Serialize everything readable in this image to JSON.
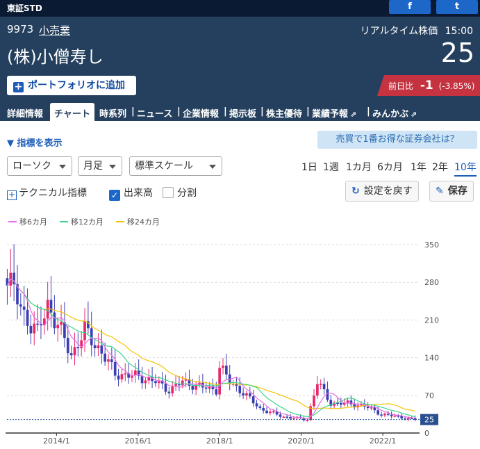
{
  "topbar": {
    "market": "東証STD",
    "facebook": "f",
    "twitter": "t"
  },
  "stock": {
    "code": "9973",
    "sector": "小売業",
    "realtime_label": "リアルタイム株価",
    "time": "15:00",
    "name": "(株)小僧寿し",
    "price": "25"
  },
  "portfolio_button": {
    "label": "ポートフォリオに追加",
    "icon": "+"
  },
  "change": {
    "label": "前日比",
    "value": "-1",
    "percent": "(-3.85%)"
  },
  "tabs": [
    {
      "label": "詳細情報"
    },
    {
      "label": "チャート"
    },
    {
      "label": "時系列"
    },
    {
      "label": "ニュース"
    },
    {
      "label": "企業情報"
    },
    {
      "label": "掲示板"
    },
    {
      "label": "株主優待"
    },
    {
      "label": "業績予報"
    },
    {
      "label": "みんかぶ"
    }
  ],
  "tab_separator": "|",
  "ext_icon": "⇗",
  "controls": {
    "indicator_toggle": "▼ 指標を表示",
    "promo": "売買で1番お得な証券会社は？",
    "chart_type": "ローソク",
    "interval": "月足",
    "scale": "標準スケール",
    "periods": [
      "1日",
      "1週",
      "1カ月",
      "6カ月",
      "1年",
      "2年",
      "10年"
    ],
    "technical": "テクニカル指標",
    "volume": "出来高",
    "split": "分割",
    "reset": "設定を戻す",
    "save": "保存",
    "reset_icon": "↻",
    "save_icon": "✎",
    "check_icon": "✓",
    "plus_icon": "+"
  },
  "chart_data": {
    "type": "candlestick",
    "legend": [
      {
        "name": "移6カ月",
        "color": "#e66ee6"
      },
      {
        "name": "移12カ月",
        "color": "#3cd68c"
      },
      {
        "name": "移24カ月",
        "color": "#f5c400"
      }
    ],
    "y_ticks": [
      0,
      70,
      140,
      210,
      280,
      350
    ],
    "ylim": [
      0,
      350
    ],
    "x_ticks": [
      "2014/1",
      "2016/1",
      "2018/1",
      "2020/1",
      "2022/1"
    ],
    "x_range": [
      "2012/10",
      "2022/11"
    ],
    "current_price": 25,
    "up_color": "#e8266b",
    "down_color": "#3b3fb3",
    "keypoints": [
      {
        "date": "2012/10",
        "close": 290
      },
      {
        "date": "2013/3",
        "close": 220
      },
      {
        "date": "2013/7",
        "close": 185
      },
      {
        "date": "2013/10",
        "close": 240
      },
      {
        "date": "2014/1",
        "close": 200
      },
      {
        "date": "2014/5",
        "close": 145
      },
      {
        "date": "2014/9",
        "close": 190
      },
      {
        "date": "2015/2",
        "close": 150
      },
      {
        "date": "2015/6",
        "close": 110
      },
      {
        "date": "2016/1",
        "close": 105
      },
      {
        "date": "2016/6",
        "close": 95
      },
      {
        "date": "2016/10",
        "close": 80
      },
      {
        "date": "2017/2",
        "close": 95
      },
      {
        "date": "2017/8",
        "close": 85
      },
      {
        "date": "2017/12",
        "close": 80
      },
      {
        "date": "2018/1",
        "close": 125
      },
      {
        "date": "2018/4",
        "close": 95
      },
      {
        "date": "2018/8",
        "close": 75
      },
      {
        "date": "2019/1",
        "close": 45
      },
      {
        "date": "2019/8",
        "close": 30
      },
      {
        "date": "2020/3",
        "close": 25
      },
      {
        "date": "2020/6",
        "close": 95
      },
      {
        "date": "2020/10",
        "close": 55
      },
      {
        "date": "2021/3",
        "close": 55
      },
      {
        "date": "2021/8",
        "close": 50
      },
      {
        "date": "2022/1",
        "close": 35
      },
      {
        "date": "2022/6",
        "close": 30
      },
      {
        "date": "2022/11",
        "close": 25
      }
    ]
  }
}
